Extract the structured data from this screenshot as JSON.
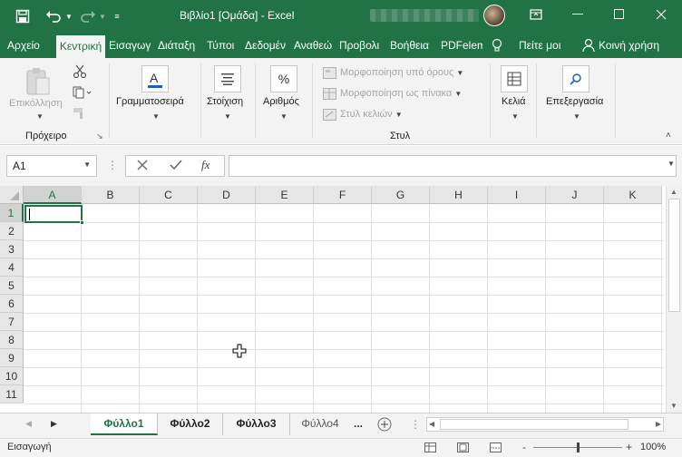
{
  "titlebar": {
    "title": "Βιβλίο1  [Ομάδα]  -  Excel",
    "undo_icon": "undo-icon",
    "redo_icon": "redo-icon"
  },
  "tabs": [
    "Αρχείο",
    "Κεντρική",
    "Εισαγωγ",
    "Διάταξη",
    "Τύποι",
    "Δεδομέν",
    "Αναθεώ",
    "Προβολι",
    "Βοήθεια",
    "PDFelem",
    "Πείτε μοι",
    "Κοινή χρήση"
  ],
  "ribbon": {
    "paste_label": "Επικόλληση",
    "clipboard_group": "Πρόχειρο",
    "font_label": "Γραμματοσειρά",
    "align_label": "Στοίχιση",
    "number_label": "Αριθμός",
    "number_icon_text": "%",
    "cond_format": "Μορφοποίηση υπό όρους",
    "format_table": "Μορφοποίηση ως πίνακα",
    "cell_styles": "Στυλ κελιών",
    "styles_group": "Στυλ",
    "cells_label": "Κελιά",
    "editing_label": "Επεξεργασία"
  },
  "formula": {
    "namebox": "A1",
    "fx": "fx",
    "value": ""
  },
  "grid": {
    "columns": [
      "A",
      "B",
      "C",
      "D",
      "E",
      "F",
      "G",
      "H",
      "I",
      "J",
      "K"
    ],
    "rows": [
      "1",
      "2",
      "3",
      "4",
      "5",
      "6",
      "7",
      "8",
      "9",
      "10",
      "11"
    ],
    "active_cell": "A1"
  },
  "sheets": {
    "tabs": [
      "Φύλλο1",
      "Φύλλο2",
      "Φύλλο3",
      "Φύλλο4"
    ],
    "more": "...",
    "add_icon": "plus-circle-icon"
  },
  "status": {
    "mode": "Εισαγωγή",
    "zoom": "100%",
    "zoom_minus": "-",
    "zoom_plus": "+"
  },
  "colors": {
    "accent": "#217346",
    "ribbon_bg": "#f3f3f3"
  }
}
